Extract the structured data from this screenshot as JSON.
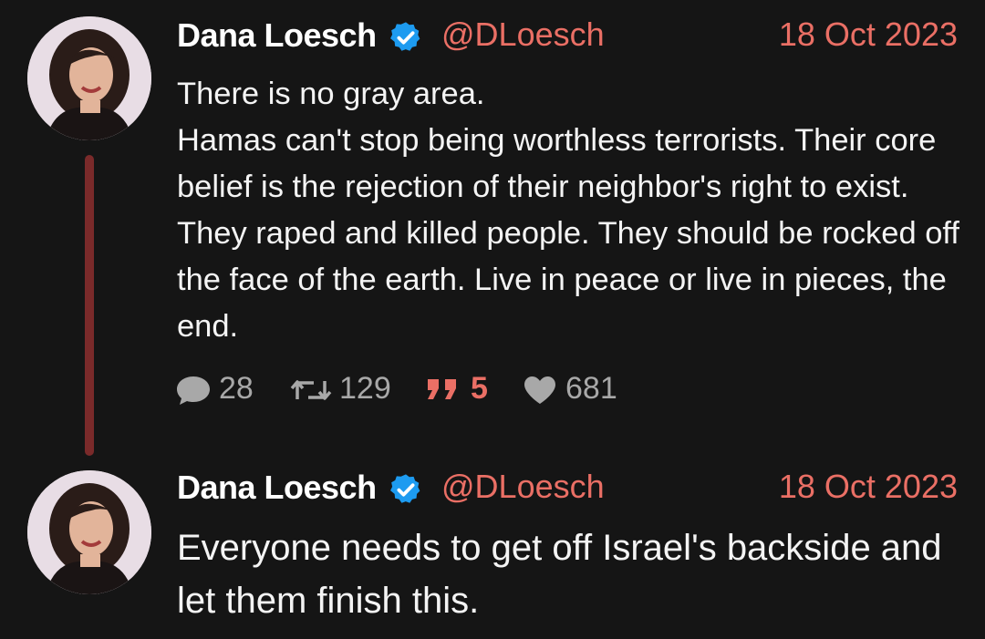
{
  "tweets": [
    {
      "author": "Dana Loesch",
      "handle": "@DLoesch",
      "date": "18 Oct 2023",
      "text": "There is no gray area.\nHamas can't stop being worthless terrorists. Their core belief is the rejection of their neighbor's right to exist. They raped and killed people. They should be rocked off the face of the earth. Live in peace or live in pieces, the end.",
      "stats": {
        "replies": "28",
        "retweets": "129",
        "quotes": "5",
        "likes": "681"
      }
    },
    {
      "author": "Dana Loesch",
      "handle": "@DLoesch",
      "date": "18 Oct 2023",
      "text": "Everyone needs to get off Israel's backside and let them finish this."
    }
  ],
  "colors": {
    "background": "#151515",
    "accent": "#ea6f65",
    "verified": "#1d9bf0",
    "thread_line": "#7a2a2a",
    "muted": "#a8a8a8"
  },
  "icons": {
    "verified": "verified-badge-icon",
    "reply": "speech-bubble-icon",
    "retweet": "retweet-arrows-icon",
    "quote": "quote-marks-icon",
    "like": "heart-icon"
  }
}
